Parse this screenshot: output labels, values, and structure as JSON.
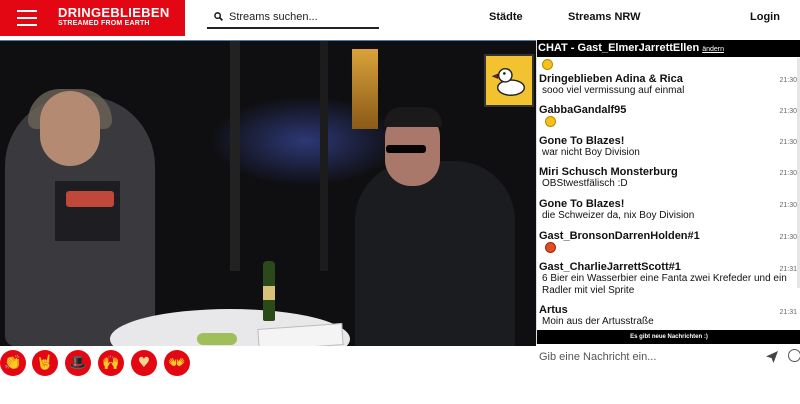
{
  "header": {
    "brand_title": "DRINGEBLIEBEN",
    "brand_subtitle": "STREAMED FROM EARTH",
    "search_placeholder": "Streams suchen...",
    "nav": [
      "Städte",
      "Streams NRW",
      "Login"
    ]
  },
  "chat": {
    "title": "CHAT - Gast_ElmerJarrettEllen",
    "change_label": "ändern",
    "notice": "Es gibt neue Nachrichten :)",
    "input_placeholder": "Gib eine Nachricht ein...",
    "messages": [
      {
        "name": "Dringeblieben Adina & Rica",
        "time": "21:30",
        "text": "sooo viel vermissung auf einmal",
        "emoji": ""
      },
      {
        "name": "GabbaGandalf95",
        "time": "21:30",
        "text": "",
        "emoji": "laughing-yellow"
      },
      {
        "name": "Gone To Blazes!",
        "time": "21:30",
        "text": "war nicht Boy Division",
        "emoji": ""
      },
      {
        "name": "Miri Schusch Monsterburg",
        "time": "21:30",
        "text": "OBStwestfälisch :D",
        "emoji": ""
      },
      {
        "name": "Gone To Blazes!",
        "time": "21:30",
        "text": "die Schweizer da, nix Boy Division",
        "emoji": ""
      },
      {
        "name": "Gast_BronsonDarrenHolden#1",
        "time": "21:30",
        "text": "",
        "emoji": "angry-red"
      },
      {
        "name": "Gast_CharlieJarrettScott#1",
        "time": "21:31",
        "text": "6 Bier ein Wasserbier  eine Fanta  zwei Krefeder und ein Radler mit viel Sprite",
        "emoji": ""
      },
      {
        "name": "Artus",
        "time": "21:31",
        "text": "Moin aus der Artusstraße",
        "emoji": ""
      }
    ]
  },
  "reactions": [
    {
      "name": "clapping-hands",
      "glyph": "👏"
    },
    {
      "name": "rock-hand",
      "glyph": "🤘"
    },
    {
      "name": "hat",
      "glyph": "🎩"
    },
    {
      "name": "raised-hands",
      "glyph": "🙌"
    },
    {
      "name": "heart-hands",
      "glyph": "♥"
    },
    {
      "name": "waving-hands",
      "glyph": "👐"
    }
  ],
  "colors": {
    "brand_red": "#e30613",
    "chat_header": "#000000"
  }
}
